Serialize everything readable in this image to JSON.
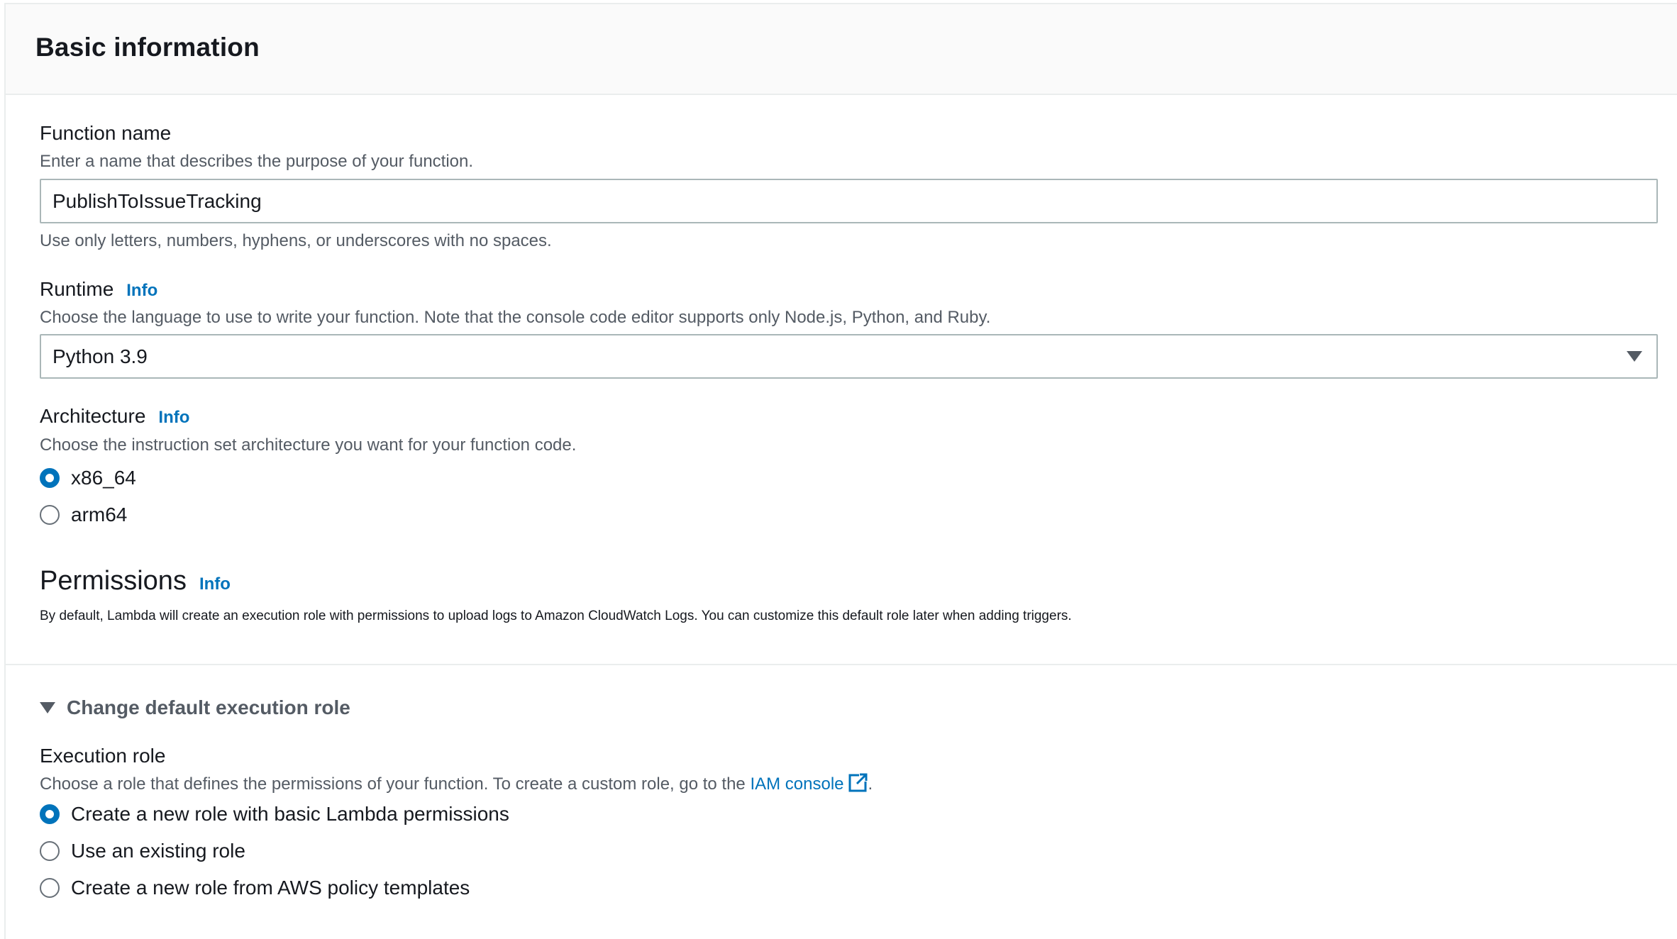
{
  "panel": {
    "title": "Basic information"
  },
  "function_name": {
    "label": "Function name",
    "description": "Enter a name that describes the purpose of your function.",
    "value": "PublishToIssueTracking",
    "constraint": "Use only letters, numbers, hyphens, or underscores with no spaces."
  },
  "runtime": {
    "label": "Runtime",
    "info": "Info",
    "description": "Choose the language to use to write your function. Note that the console code editor supports only Node.js, Python, and Ruby.",
    "selected": "Python 3.9"
  },
  "architecture": {
    "label": "Architecture",
    "info": "Info",
    "description": "Choose the instruction set architecture you want for your function code.",
    "options": [
      {
        "label": "x86_64",
        "checked": true
      },
      {
        "label": "arm64",
        "checked": false
      }
    ]
  },
  "permissions": {
    "heading": "Permissions",
    "info": "Info",
    "description": "By default, Lambda will create an execution role with permissions to upload logs to Amazon CloudWatch Logs. You can customize this default role later when adding triggers."
  },
  "change_role": {
    "label": "Change default execution role",
    "expanded": true
  },
  "execution_role": {
    "label": "Execution role",
    "description_prefix": "Choose a role that defines the permissions of your function. To create a custom role, go to the ",
    "link_text": "IAM console",
    "description_suffix": ".",
    "options": [
      {
        "label": "Create a new role with basic Lambda permissions",
        "checked": true
      },
      {
        "label": "Use an existing role",
        "checked": false
      },
      {
        "label": "Create a new role from AWS policy templates",
        "checked": false
      }
    ]
  },
  "colors": {
    "accent": "#0073bb",
    "text": "#16191f",
    "muted": "#545b64",
    "border": "#aab7b8"
  }
}
